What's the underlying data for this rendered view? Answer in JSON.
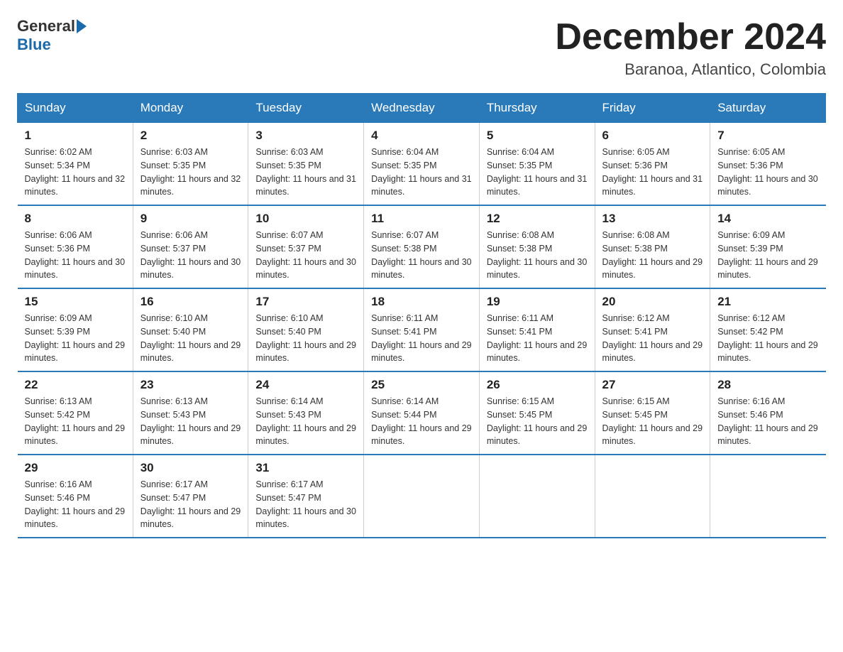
{
  "logo": {
    "general": "General",
    "blue": "Blue"
  },
  "title": "December 2024",
  "subtitle": "Baranoa, Atlantico, Colombia",
  "days_of_week": [
    "Sunday",
    "Monday",
    "Tuesday",
    "Wednesday",
    "Thursday",
    "Friday",
    "Saturday"
  ],
  "weeks": [
    [
      {
        "day": "1",
        "sunrise": "6:02 AM",
        "sunset": "5:34 PM",
        "daylight": "11 hours and 32 minutes."
      },
      {
        "day": "2",
        "sunrise": "6:03 AM",
        "sunset": "5:35 PM",
        "daylight": "11 hours and 32 minutes."
      },
      {
        "day": "3",
        "sunrise": "6:03 AM",
        "sunset": "5:35 PM",
        "daylight": "11 hours and 31 minutes."
      },
      {
        "day": "4",
        "sunrise": "6:04 AM",
        "sunset": "5:35 PM",
        "daylight": "11 hours and 31 minutes."
      },
      {
        "day": "5",
        "sunrise": "6:04 AM",
        "sunset": "5:35 PM",
        "daylight": "11 hours and 31 minutes."
      },
      {
        "day": "6",
        "sunrise": "6:05 AM",
        "sunset": "5:36 PM",
        "daylight": "11 hours and 31 minutes."
      },
      {
        "day": "7",
        "sunrise": "6:05 AM",
        "sunset": "5:36 PM",
        "daylight": "11 hours and 30 minutes."
      }
    ],
    [
      {
        "day": "8",
        "sunrise": "6:06 AM",
        "sunset": "5:36 PM",
        "daylight": "11 hours and 30 minutes."
      },
      {
        "day": "9",
        "sunrise": "6:06 AM",
        "sunset": "5:37 PM",
        "daylight": "11 hours and 30 minutes."
      },
      {
        "day": "10",
        "sunrise": "6:07 AM",
        "sunset": "5:37 PM",
        "daylight": "11 hours and 30 minutes."
      },
      {
        "day": "11",
        "sunrise": "6:07 AM",
        "sunset": "5:38 PM",
        "daylight": "11 hours and 30 minutes."
      },
      {
        "day": "12",
        "sunrise": "6:08 AM",
        "sunset": "5:38 PM",
        "daylight": "11 hours and 30 minutes."
      },
      {
        "day": "13",
        "sunrise": "6:08 AM",
        "sunset": "5:38 PM",
        "daylight": "11 hours and 29 minutes."
      },
      {
        "day": "14",
        "sunrise": "6:09 AM",
        "sunset": "5:39 PM",
        "daylight": "11 hours and 29 minutes."
      }
    ],
    [
      {
        "day": "15",
        "sunrise": "6:09 AM",
        "sunset": "5:39 PM",
        "daylight": "11 hours and 29 minutes."
      },
      {
        "day": "16",
        "sunrise": "6:10 AM",
        "sunset": "5:40 PM",
        "daylight": "11 hours and 29 minutes."
      },
      {
        "day": "17",
        "sunrise": "6:10 AM",
        "sunset": "5:40 PM",
        "daylight": "11 hours and 29 minutes."
      },
      {
        "day": "18",
        "sunrise": "6:11 AM",
        "sunset": "5:41 PM",
        "daylight": "11 hours and 29 minutes."
      },
      {
        "day": "19",
        "sunrise": "6:11 AM",
        "sunset": "5:41 PM",
        "daylight": "11 hours and 29 minutes."
      },
      {
        "day": "20",
        "sunrise": "6:12 AM",
        "sunset": "5:41 PM",
        "daylight": "11 hours and 29 minutes."
      },
      {
        "day": "21",
        "sunrise": "6:12 AM",
        "sunset": "5:42 PM",
        "daylight": "11 hours and 29 minutes."
      }
    ],
    [
      {
        "day": "22",
        "sunrise": "6:13 AM",
        "sunset": "5:42 PM",
        "daylight": "11 hours and 29 minutes."
      },
      {
        "day": "23",
        "sunrise": "6:13 AM",
        "sunset": "5:43 PM",
        "daylight": "11 hours and 29 minutes."
      },
      {
        "day": "24",
        "sunrise": "6:14 AM",
        "sunset": "5:43 PM",
        "daylight": "11 hours and 29 minutes."
      },
      {
        "day": "25",
        "sunrise": "6:14 AM",
        "sunset": "5:44 PM",
        "daylight": "11 hours and 29 minutes."
      },
      {
        "day": "26",
        "sunrise": "6:15 AM",
        "sunset": "5:45 PM",
        "daylight": "11 hours and 29 minutes."
      },
      {
        "day": "27",
        "sunrise": "6:15 AM",
        "sunset": "5:45 PM",
        "daylight": "11 hours and 29 minutes."
      },
      {
        "day": "28",
        "sunrise": "6:16 AM",
        "sunset": "5:46 PM",
        "daylight": "11 hours and 29 minutes."
      }
    ],
    [
      {
        "day": "29",
        "sunrise": "6:16 AM",
        "sunset": "5:46 PM",
        "daylight": "11 hours and 29 minutes."
      },
      {
        "day": "30",
        "sunrise": "6:17 AM",
        "sunset": "5:47 PM",
        "daylight": "11 hours and 29 minutes."
      },
      {
        "day": "31",
        "sunrise": "6:17 AM",
        "sunset": "5:47 PM",
        "daylight": "11 hours and 30 minutes."
      },
      null,
      null,
      null,
      null
    ]
  ]
}
